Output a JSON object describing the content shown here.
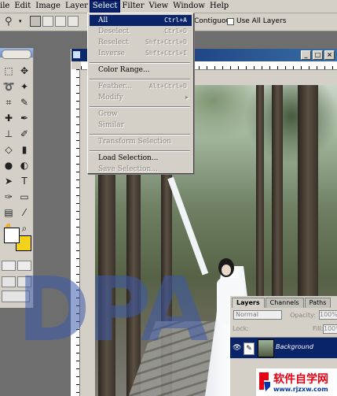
{
  "menubar": {
    "items": [
      "ile",
      "Edit",
      "Image",
      "Layer",
      "Select",
      "Filter",
      "View",
      "Window",
      "Help"
    ],
    "active_index": 4
  },
  "options_bar": {
    "contiguous_label": "Contiguous",
    "use_all_layers_label": "Use All Layers"
  },
  "select_menu": {
    "items": [
      {
        "label": "All",
        "shortcut": "Ctrl+A",
        "state": "highlighted"
      },
      {
        "label": "Deselect",
        "shortcut": "Ctrl+D",
        "state": "disabled"
      },
      {
        "label": "Reselect",
        "shortcut": "Shft+Ctrl+D",
        "state": "disabled"
      },
      {
        "label": "Inverse",
        "shortcut": "Shft+Ctrl+I",
        "state": "disabled"
      },
      {
        "label": "Color Range...",
        "shortcut": "",
        "state": "enabled"
      },
      {
        "label": "Feather...",
        "shortcut": "Alt+Ctrl+D",
        "state": "disabled"
      },
      {
        "label": "Modify",
        "shortcut": "",
        "state": "disabled",
        "submenu": true
      },
      {
        "label": "Grow",
        "shortcut": "",
        "state": "disabled"
      },
      {
        "label": "Similar",
        "shortcut": "",
        "state": "disabled"
      },
      {
        "label": "Transform Selection",
        "shortcut": "",
        "state": "disabled"
      },
      {
        "label": "Load Selection...",
        "shortcut": "",
        "state": "enabled"
      },
      {
        "label": "Save Selection...",
        "shortcut": "",
        "state": "disabled"
      }
    ]
  },
  "watermark": "DPA",
  "layers_panel": {
    "tabs": [
      "Layers",
      "Channels",
      "Paths"
    ],
    "blend_mode": "Normal",
    "opacity_label": "Opacity:",
    "opacity_value": "100%",
    "lock_label": "Lock:",
    "fill_label": "Fill:",
    "fill_value": "100%",
    "layer_name": "Background"
  },
  "logo": {
    "title": "软件自学网",
    "url": "www.rjzxw.com"
  },
  "colors": {
    "menu_highlight": "#0a246a",
    "foreground": "#ffffff",
    "background": "#f4d21a"
  }
}
